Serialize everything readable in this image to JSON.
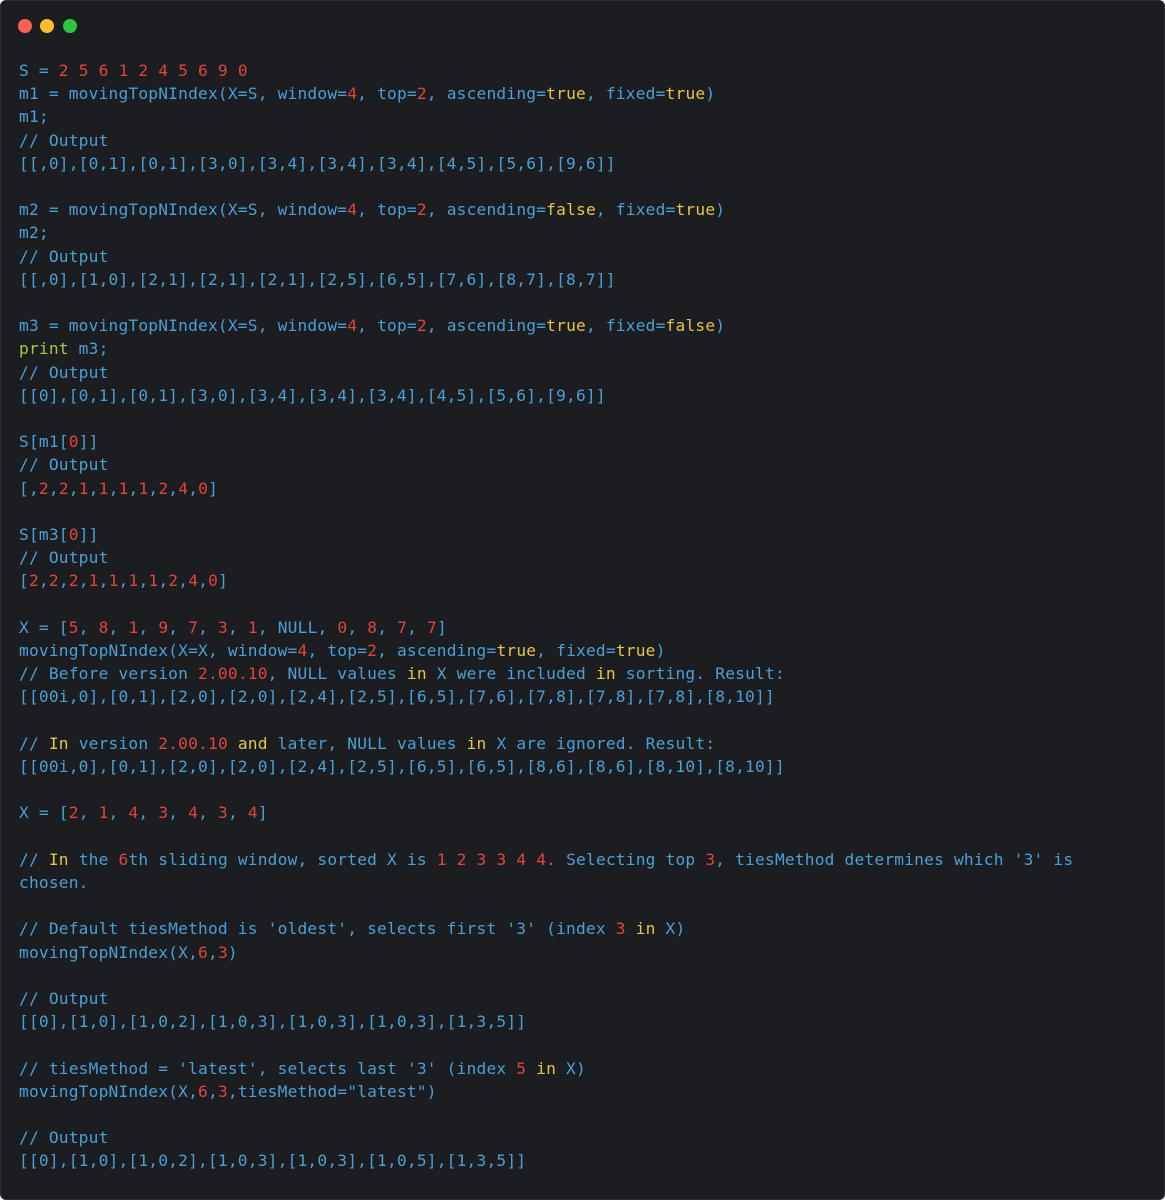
{
  "colors": {
    "background": "#1c1d20",
    "text": "#4aa0d6",
    "number": "#e0453c",
    "keyword": "#e7c547",
    "print": "#a6c93b",
    "close_button": "#ff5f57",
    "minimize_button": "#febc2e",
    "maximize_button": "#28c840"
  },
  "window_controls": [
    "close",
    "minimize",
    "maximize"
  ],
  "lines": [
    [
      [
        "S = ",
        "t"
      ],
      [
        "2 5 6 1 2 4 5 6 9 0",
        "n"
      ]
    ],
    [
      [
        "m1 = movingTopNIndex(X=S, window=",
        "t"
      ],
      [
        "4",
        "n"
      ],
      [
        ", top=",
        "t"
      ],
      [
        "2",
        "n"
      ],
      [
        ", ascending=",
        "t"
      ],
      [
        "true",
        "k"
      ],
      [
        ", fixed=",
        "t"
      ],
      [
        "true",
        "k"
      ],
      [
        ")",
        "t"
      ]
    ],
    [
      [
        "m1;",
        "t"
      ]
    ],
    [
      [
        "// Output",
        "t"
      ]
    ],
    [
      [
        "[[,0],[0,1],[0,1],[3,0],[3,4],[3,4],[3,4],[4,5],[5,6],[9,6]]",
        "t"
      ]
    ],
    [],
    [
      [
        "m2 = movingTopNIndex(X=S, window=",
        "t"
      ],
      [
        "4",
        "n"
      ],
      [
        ", top=",
        "t"
      ],
      [
        "2",
        "n"
      ],
      [
        ", ascending=",
        "t"
      ],
      [
        "false",
        "k"
      ],
      [
        ", fixed=",
        "t"
      ],
      [
        "true",
        "k"
      ],
      [
        ")",
        "t"
      ]
    ],
    [
      [
        "m2;",
        "t"
      ]
    ],
    [
      [
        "// Output",
        "t"
      ]
    ],
    [
      [
        "[[,0],[1,0],[2,1],[2,1],[2,1],[2,5],[6,5],[7,6],[8,7],[8,7]]",
        "t"
      ]
    ],
    [],
    [
      [
        "m3 = movingTopNIndex(X=S, window=",
        "t"
      ],
      [
        "4",
        "n"
      ],
      [
        ", top=",
        "t"
      ],
      [
        "2",
        "n"
      ],
      [
        ", ascending=",
        "t"
      ],
      [
        "true",
        "k"
      ],
      [
        ", fixed=",
        "t"
      ],
      [
        "false",
        "k"
      ],
      [
        ")",
        "t"
      ]
    ],
    [
      [
        "print",
        "p"
      ],
      [
        " m3;",
        "t"
      ]
    ],
    [
      [
        "// Output",
        "t"
      ]
    ],
    [
      [
        "[[0],[0,1],[0,1],[3,0],[3,4],[3,4],[3,4],[4,5],[5,6],[9,6]]",
        "t"
      ]
    ],
    [],
    [
      [
        "S[m1[",
        "t"
      ],
      [
        "0",
        "n"
      ],
      [
        "]]",
        "t"
      ]
    ],
    [
      [
        "// Output",
        "t"
      ]
    ],
    [
      [
        "[,",
        "t"
      ],
      [
        "2",
        "n"
      ],
      [
        ",",
        "t"
      ],
      [
        "2",
        "n"
      ],
      [
        ",",
        "t"
      ],
      [
        "1",
        "n"
      ],
      [
        ",",
        "t"
      ],
      [
        "1",
        "n"
      ],
      [
        ",",
        "t"
      ],
      [
        "1",
        "n"
      ],
      [
        ",",
        "t"
      ],
      [
        "1",
        "n"
      ],
      [
        ",",
        "t"
      ],
      [
        "2",
        "n"
      ],
      [
        ",",
        "t"
      ],
      [
        "4",
        "n"
      ],
      [
        ",",
        "t"
      ],
      [
        "0",
        "n"
      ],
      [
        "]",
        "t"
      ]
    ],
    [],
    [
      [
        "S[m3[",
        "t"
      ],
      [
        "0",
        "n"
      ],
      [
        "]]",
        "t"
      ]
    ],
    [
      [
        "// Output",
        "t"
      ]
    ],
    [
      [
        "[",
        "t"
      ],
      [
        "2",
        "n"
      ],
      [
        ",",
        "t"
      ],
      [
        "2",
        "n"
      ],
      [
        ",",
        "t"
      ],
      [
        "2",
        "n"
      ],
      [
        ",",
        "t"
      ],
      [
        "1",
        "n"
      ],
      [
        ",",
        "t"
      ],
      [
        "1",
        "n"
      ],
      [
        ",",
        "t"
      ],
      [
        "1",
        "n"
      ],
      [
        ",",
        "t"
      ],
      [
        "1",
        "n"
      ],
      [
        ",",
        "t"
      ],
      [
        "2",
        "n"
      ],
      [
        ",",
        "t"
      ],
      [
        "4",
        "n"
      ],
      [
        ",",
        "t"
      ],
      [
        "0",
        "n"
      ],
      [
        "]",
        "t"
      ]
    ],
    [],
    [
      [
        "X = [",
        "t"
      ],
      [
        "5",
        "n"
      ],
      [
        ", ",
        "t"
      ],
      [
        "8",
        "n"
      ],
      [
        ", ",
        "t"
      ],
      [
        "1",
        "n"
      ],
      [
        ", ",
        "t"
      ],
      [
        "9",
        "n"
      ],
      [
        ", ",
        "t"
      ],
      [
        "7",
        "n"
      ],
      [
        ", ",
        "t"
      ],
      [
        "3",
        "n"
      ],
      [
        ", ",
        "t"
      ],
      [
        "1",
        "n"
      ],
      [
        ", NULL, ",
        "t"
      ],
      [
        "0",
        "n"
      ],
      [
        ", ",
        "t"
      ],
      [
        "8",
        "n"
      ],
      [
        ", ",
        "t"
      ],
      [
        "7",
        "n"
      ],
      [
        ", ",
        "t"
      ],
      [
        "7",
        "n"
      ],
      [
        "]",
        "t"
      ]
    ],
    [
      [
        "movingTopNIndex(X=X, window=",
        "t"
      ],
      [
        "4",
        "n"
      ],
      [
        ", top=",
        "t"
      ],
      [
        "2",
        "n"
      ],
      [
        ", ascending=",
        "t"
      ],
      [
        "true",
        "k"
      ],
      [
        ", fixed=",
        "t"
      ],
      [
        "true",
        "k"
      ],
      [
        ")",
        "t"
      ]
    ],
    [
      [
        "// Before version ",
        "t"
      ],
      [
        "2.00.10",
        "n"
      ],
      [
        ", NULL values ",
        "t"
      ],
      [
        "in",
        "k"
      ],
      [
        " X were included ",
        "t"
      ],
      [
        "in",
        "k"
      ],
      [
        " sorting. Result:",
        "t"
      ]
    ],
    [
      [
        "[[00i,0],[0,1],[2,0],[2,0],[2,4],[2,5],[6,5],[7,6],[7,8],[7,8],[7,8],[8,10]]",
        "t"
      ]
    ],
    [],
    [
      [
        "// ",
        "t"
      ],
      [
        "In",
        "k"
      ],
      [
        " version ",
        "t"
      ],
      [
        "2.00.10",
        "n"
      ],
      [
        " ",
        "t"
      ],
      [
        "and",
        "k"
      ],
      [
        " later, NULL values ",
        "t"
      ],
      [
        "in",
        "k"
      ],
      [
        " X are ignored. Result:",
        "t"
      ]
    ],
    [
      [
        "[[00i,0],[0,1],[2,0],[2,0],[2,4],[2,5],[6,5],[6,5],[8,6],[8,6],[8,10],[8,10]]",
        "t"
      ]
    ],
    [],
    [
      [
        "X = [",
        "t"
      ],
      [
        "2",
        "n"
      ],
      [
        ", ",
        "t"
      ],
      [
        "1",
        "n"
      ],
      [
        ", ",
        "t"
      ],
      [
        "4",
        "n"
      ],
      [
        ", ",
        "t"
      ],
      [
        "3",
        "n"
      ],
      [
        ", ",
        "t"
      ],
      [
        "4",
        "n"
      ],
      [
        ", ",
        "t"
      ],
      [
        "3",
        "n"
      ],
      [
        ", ",
        "t"
      ],
      [
        "4",
        "n"
      ],
      [
        "]",
        "t"
      ]
    ],
    [],
    [
      [
        "// ",
        "t"
      ],
      [
        "In",
        "k"
      ],
      [
        " the ",
        "t"
      ],
      [
        "6",
        "n"
      ],
      [
        "th sliding window, sorted X is ",
        "t"
      ],
      [
        "1 2 3 3 4 4.",
        "n"
      ],
      [
        " Selecting top ",
        "t"
      ],
      [
        "3",
        "n"
      ],
      [
        ", tiesMethod determines which '3' is chosen.",
        "t"
      ]
    ],
    [],
    [
      [
        "// Default tiesMethod is 'oldest', selects first '3' (index ",
        "t"
      ],
      [
        "3",
        "n"
      ],
      [
        " ",
        "t"
      ],
      [
        "in",
        "k"
      ],
      [
        " X)",
        "t"
      ]
    ],
    [
      [
        "movingTopNIndex(X,",
        "t"
      ],
      [
        "6",
        "n"
      ],
      [
        ",",
        "t"
      ],
      [
        "3",
        "n"
      ],
      [
        ")",
        "t"
      ]
    ],
    [],
    [
      [
        "// Output",
        "t"
      ]
    ],
    [
      [
        "[[0],[1,0],[1,0,2],[1,0,3],[1,0,3],[1,0,3],[1,3,5]]",
        "t"
      ]
    ],
    [],
    [
      [
        "// tiesMethod = 'latest', selects last '3' (index ",
        "t"
      ],
      [
        "5",
        "n"
      ],
      [
        " ",
        "t"
      ],
      [
        "in",
        "k"
      ],
      [
        " X)",
        "t"
      ]
    ],
    [
      [
        "movingTopNIndex(X,",
        "t"
      ],
      [
        "6",
        "n"
      ],
      [
        ",",
        "t"
      ],
      [
        "3",
        "n"
      ],
      [
        ",tiesMethod=\"latest\")",
        "t"
      ]
    ],
    [],
    [
      [
        "// Output",
        "t"
      ]
    ],
    [
      [
        "[[0],[1,0],[1,0,2],[1,0,3],[1,0,3],[1,0,5],[1,3,5]]",
        "t"
      ]
    ]
  ]
}
